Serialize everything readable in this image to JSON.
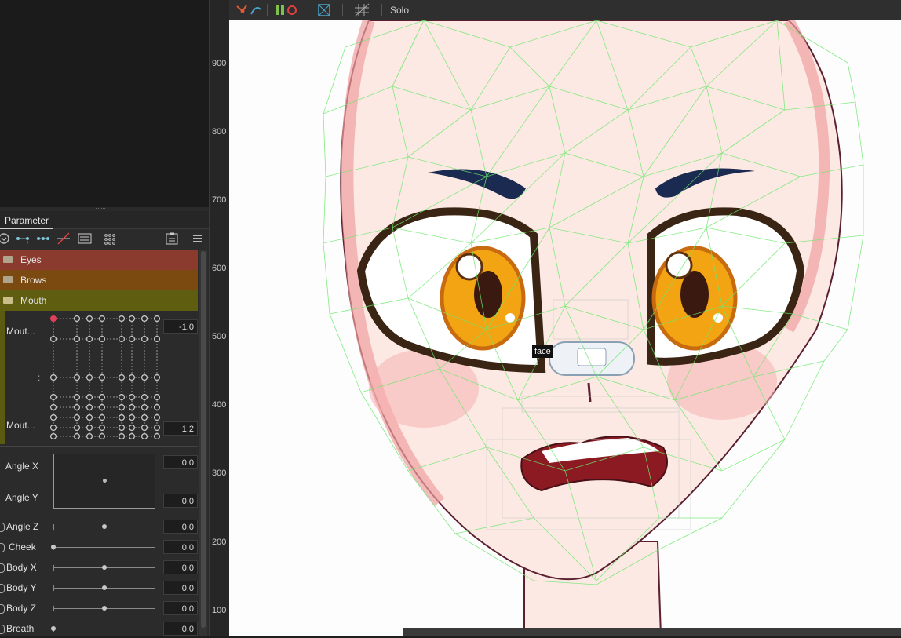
{
  "panel": {
    "tab_label": "Parameter"
  },
  "groups": [
    {
      "label": "Eyes",
      "color": "#8b3a2e"
    },
    {
      "label": "Brows",
      "color": "#7a4a10"
    },
    {
      "label": "Mouth",
      "color": "#5f5e10"
    }
  ],
  "mouth_param": {
    "top_label": "Mout...",
    "bottom_label": "Mout...",
    "top_value": "-1.0",
    "bottom_value": "1.2",
    "middle_mark": ":"
  },
  "angle_xy": {
    "label_x": "Angle X",
    "label_y": "Angle Y",
    "value_x": "0.0",
    "value_y": "0.0"
  },
  "sliders": [
    {
      "label": "Angle Z",
      "value": "0.0",
      "level": 0.5
    },
    {
      "label": "Cheek",
      "value": "0.0",
      "level": 0.0
    },
    {
      "label": "Body X",
      "value": "0.0",
      "level": 0.5
    },
    {
      "label": "Body Y",
      "value": "0.0",
      "level": 0.5
    },
    {
      "label": "Body Z",
      "value": "0.0",
      "level": 0.5
    },
    {
      "label": "Breath",
      "value": "0.0",
      "level": 0.0
    }
  ],
  "ruler": {
    "ticks": [
      "900",
      "800",
      "700",
      "600",
      "500",
      "400",
      "300",
      "200",
      "100"
    ]
  },
  "canvas_toolbar": {
    "solo_label": "Solo"
  },
  "tooltip": {
    "text": "face"
  },
  "colors": {
    "mesh": "#6ee86e",
    "iris": "#f2a412",
    "brow": "#1a2a50",
    "skin": "#fde9e3",
    "selected_point": "#e0405a"
  },
  "icons": [
    "deformer-icon",
    "blend-icon",
    "mesh-edit-icon",
    "grid-icon",
    "collapse-icon",
    "add-key-icon",
    "remove-key-icon",
    "list-view-icon",
    "clipboard-icon",
    "menu-icon"
  ]
}
